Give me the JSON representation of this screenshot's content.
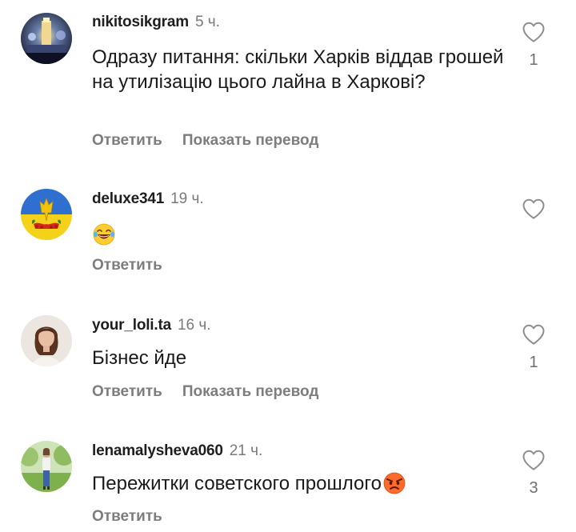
{
  "comments": [
    {
      "username": "nikitosikgram",
      "time": "5 ч.",
      "text": "Одразу питання: скільки Харків віддав грошей на утилізацію цього лайна в Харкові?",
      "reply_label": "Ответить",
      "translate_label": "Показать перевод",
      "likes": "1",
      "avatar_icon": "city-fountain-night-avatar"
    },
    {
      "username": "deluxe341",
      "time": "19 ч.",
      "text": "",
      "emoji": "laughing-tears-emoji",
      "reply_label": "Ответить",
      "likes": "",
      "avatar_icon": "ukraine-trident-flag-avatar"
    },
    {
      "username": "your_loli.ta",
      "time": "16 ч.",
      "text": "Бізнес йде",
      "reply_label": "Ответить",
      "translate_label": "Показать перевод",
      "likes": "1",
      "avatar_icon": "woman-portrait-avatar"
    },
    {
      "username": "lenamalysheva060",
      "time": "21 ч.",
      "text": "Пережитки советского прошлого",
      "emoji": "angry-face-emoji",
      "reply_label": "Ответить",
      "likes": "3",
      "avatar_icon": "woman-in-park-avatar"
    }
  ],
  "colors": {
    "username": "#1e1e1e",
    "meta": "#7a7a7a",
    "text": "#1a1a1a",
    "heart_outline": "#8e8e8e"
  }
}
